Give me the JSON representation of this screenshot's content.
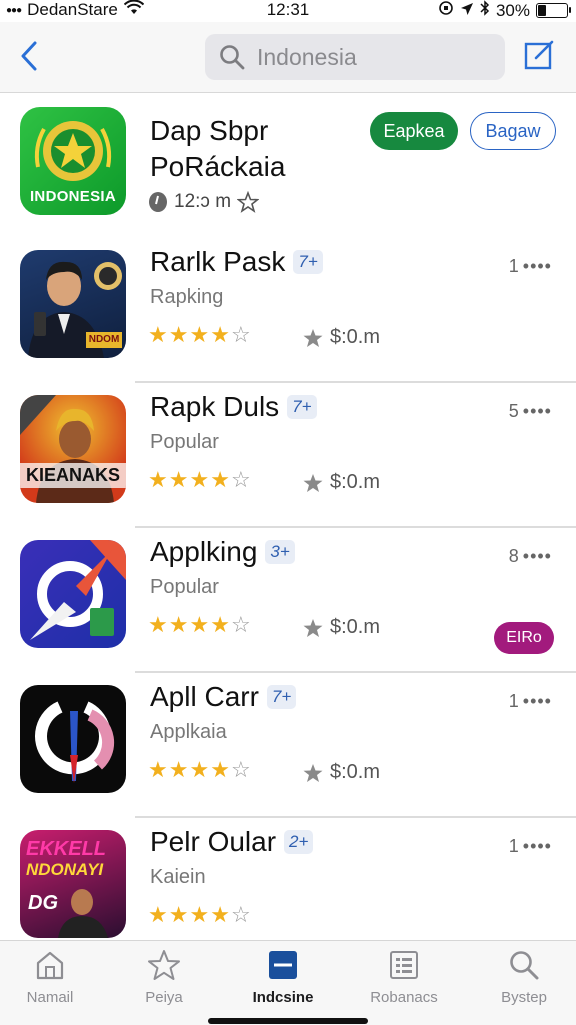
{
  "status_bar": {
    "carrier": "DedanStare",
    "time": "12:31",
    "battery": "30%",
    "battery_level": 0.3
  },
  "nav": {
    "back_icon": "chevron-left-icon",
    "search_placeholder": "Indonesia",
    "compose_icon": "compose-icon"
  },
  "featured": {
    "icon_label": "INDONESIA",
    "title_line1": "Dap Sbpr",
    "title_line2": "PoRáckaia",
    "meta": "12:ↄ m",
    "primary_button": "Eapkea",
    "secondary_button": "Bagaw",
    "colors": {
      "primary": "#17893f",
      "secondary": "#2a64c4"
    }
  },
  "apps": [
    {
      "title": "Rarlk Pask",
      "badge": "7+",
      "subtitle": "Rapking",
      "rank": "1",
      "rating": 4,
      "price": "$:0.m"
    },
    {
      "title": "Rapk Duls",
      "badge": "7+",
      "subtitle": "Popular",
      "rank": "5",
      "rating": 4,
      "price": "$:0.m"
    },
    {
      "title": "Applking",
      "badge": "3+",
      "subtitle": "Popular",
      "rank": "8",
      "rating": 4,
      "price": "$:0.m",
      "tag": "EIRo"
    },
    {
      "title": "Apll Carr",
      "badge": "7+",
      "subtitle": "Applkaia",
      "rank": "1",
      "rating": 4,
      "price": "$:0.m"
    },
    {
      "title": "Pelr Oular",
      "badge": "2+",
      "subtitle": "Kaiein",
      "rank": "1",
      "rating": 4,
      "price": ""
    }
  ],
  "icon_text": {
    "app1_badge": "NDOM",
    "app2_banner": "KIEANAKS",
    "app5_line1": "EKKELL",
    "app5_line2": "NDONAYI",
    "app5_line3": "DG"
  },
  "tabs": [
    {
      "label": "Namail",
      "icon": "home-icon"
    },
    {
      "label": "Peiya",
      "icon": "star-icon"
    },
    {
      "label": "Indcsine",
      "icon": "square-minus-icon"
    },
    {
      "label": "Robanacs",
      "icon": "grid-list-icon"
    },
    {
      "label": "Bystep",
      "icon": "search-icon"
    }
  ],
  "active_tab": 2
}
